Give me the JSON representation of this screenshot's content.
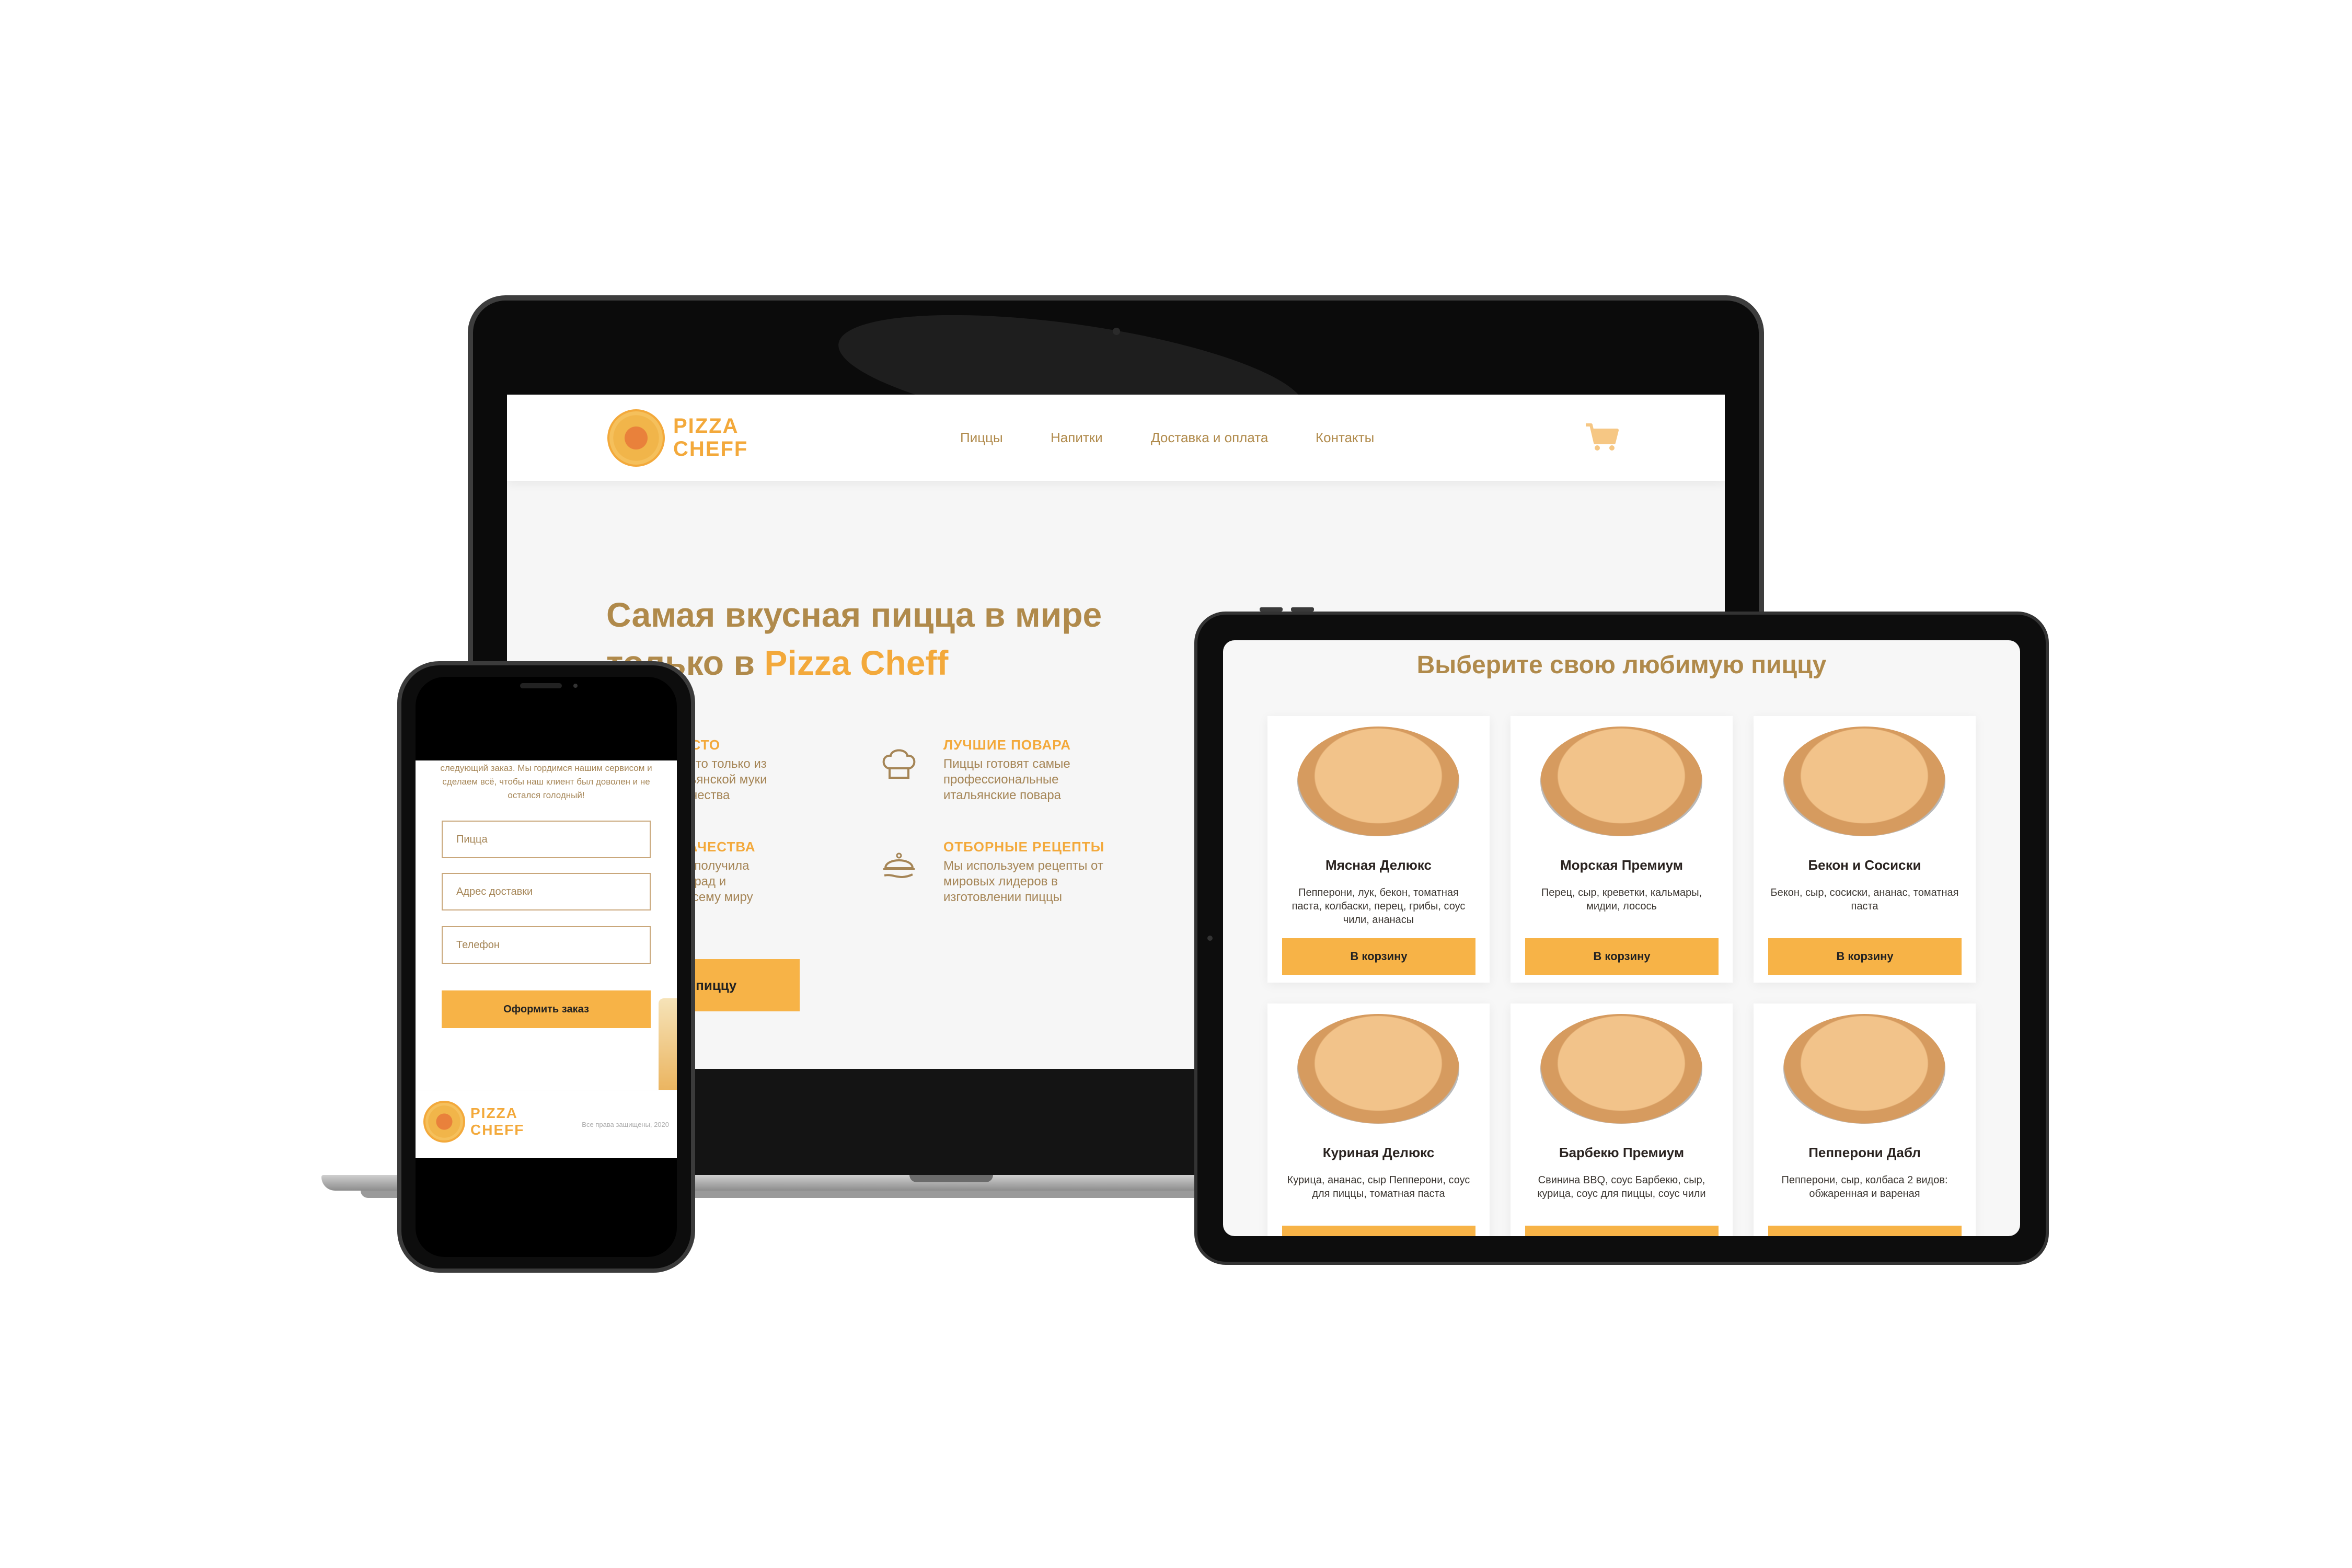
{
  "brand": {
    "line1": "PIZZA",
    "line2": "CHEFF"
  },
  "nav": {
    "items": [
      "Пиццы",
      "Напитки",
      "Доставка и оплата",
      "Контакты"
    ]
  },
  "hero": {
    "title_line1": "Самая вкусная пицца в мире",
    "title_line2_prefix": "только в ",
    "title_line2_accent": "Pizza Cheff",
    "cta": "ать пиццу"
  },
  "features": [
    {
      "title": "ЧШЕЕ ТЕСТО",
      "text": "создаем тесто только из\nорной итальянской муки\nвысшего качества",
      "icon": "dough-icon"
    },
    {
      "title": "ЛУЧШИЕ ПОВАРА",
      "text": "Пиццы готовят самые\nпрофессиональные\nитальянские повара",
      "icon": "chef-hat-icon"
    },
    {
      "title": "АНТИЯ КАЧЕСТВА",
      "text": "а пиццерия получила\nожество наград и\nзнаний по всему миру",
      "icon": "medal-icon"
    },
    {
      "title": "ОТБОРНЫЕ РЕЦЕПТЫ",
      "text": "Мы используем рецепты от\nмировых лидеров в\nизготовлении пиццы",
      "icon": "cloche-icon"
    }
  ],
  "tablet": {
    "title": "Выберите свою любимую пиццу",
    "button_label": "В корзину",
    "pizzas": [
      {
        "name": "Мясная Делюкс",
        "desc": "Пепперони, лук, бекон, томатная паста, колбаски, перец, грибы, соус чили, ананасы"
      },
      {
        "name": "Морская Премиум",
        "desc": "Перец, сыр, креветки, кальмары, мидии, лосось"
      },
      {
        "name": "Бекон и Сосиски",
        "desc": "Бекон, сыр, сосиски, ананас, томатная паста"
      },
      {
        "name": "Куриная Делюкс",
        "desc": "Курица, ананас, сыр Пепперони, соус для пиццы, томатная паста"
      },
      {
        "name": "Барбекю Премиум",
        "desc": "Свинина BBQ, соус Барбекю, сыр, курица, соус для пиццы, соус чили"
      },
      {
        "name": "Пепперони Дабл",
        "desc": "Пепперони, сыр, колбаса 2 видов: обжаренная и вареная"
      }
    ]
  },
  "phone": {
    "intro": "следующий заказ. Мы гордимся нашим сервисом и сделаем всё, чтобы наш клиент был доволен и не остался голодный!",
    "placeholders": {
      "pizza": "Пицца",
      "address": "Адрес доставки",
      "phone": "Телефон"
    },
    "submit": "Оформить заказ",
    "copyright": "Все права защищены, 2020"
  },
  "colors": {
    "accent": "#f3a93b",
    "button": "#f7b347",
    "text_brown": "#b08a4b"
  }
}
